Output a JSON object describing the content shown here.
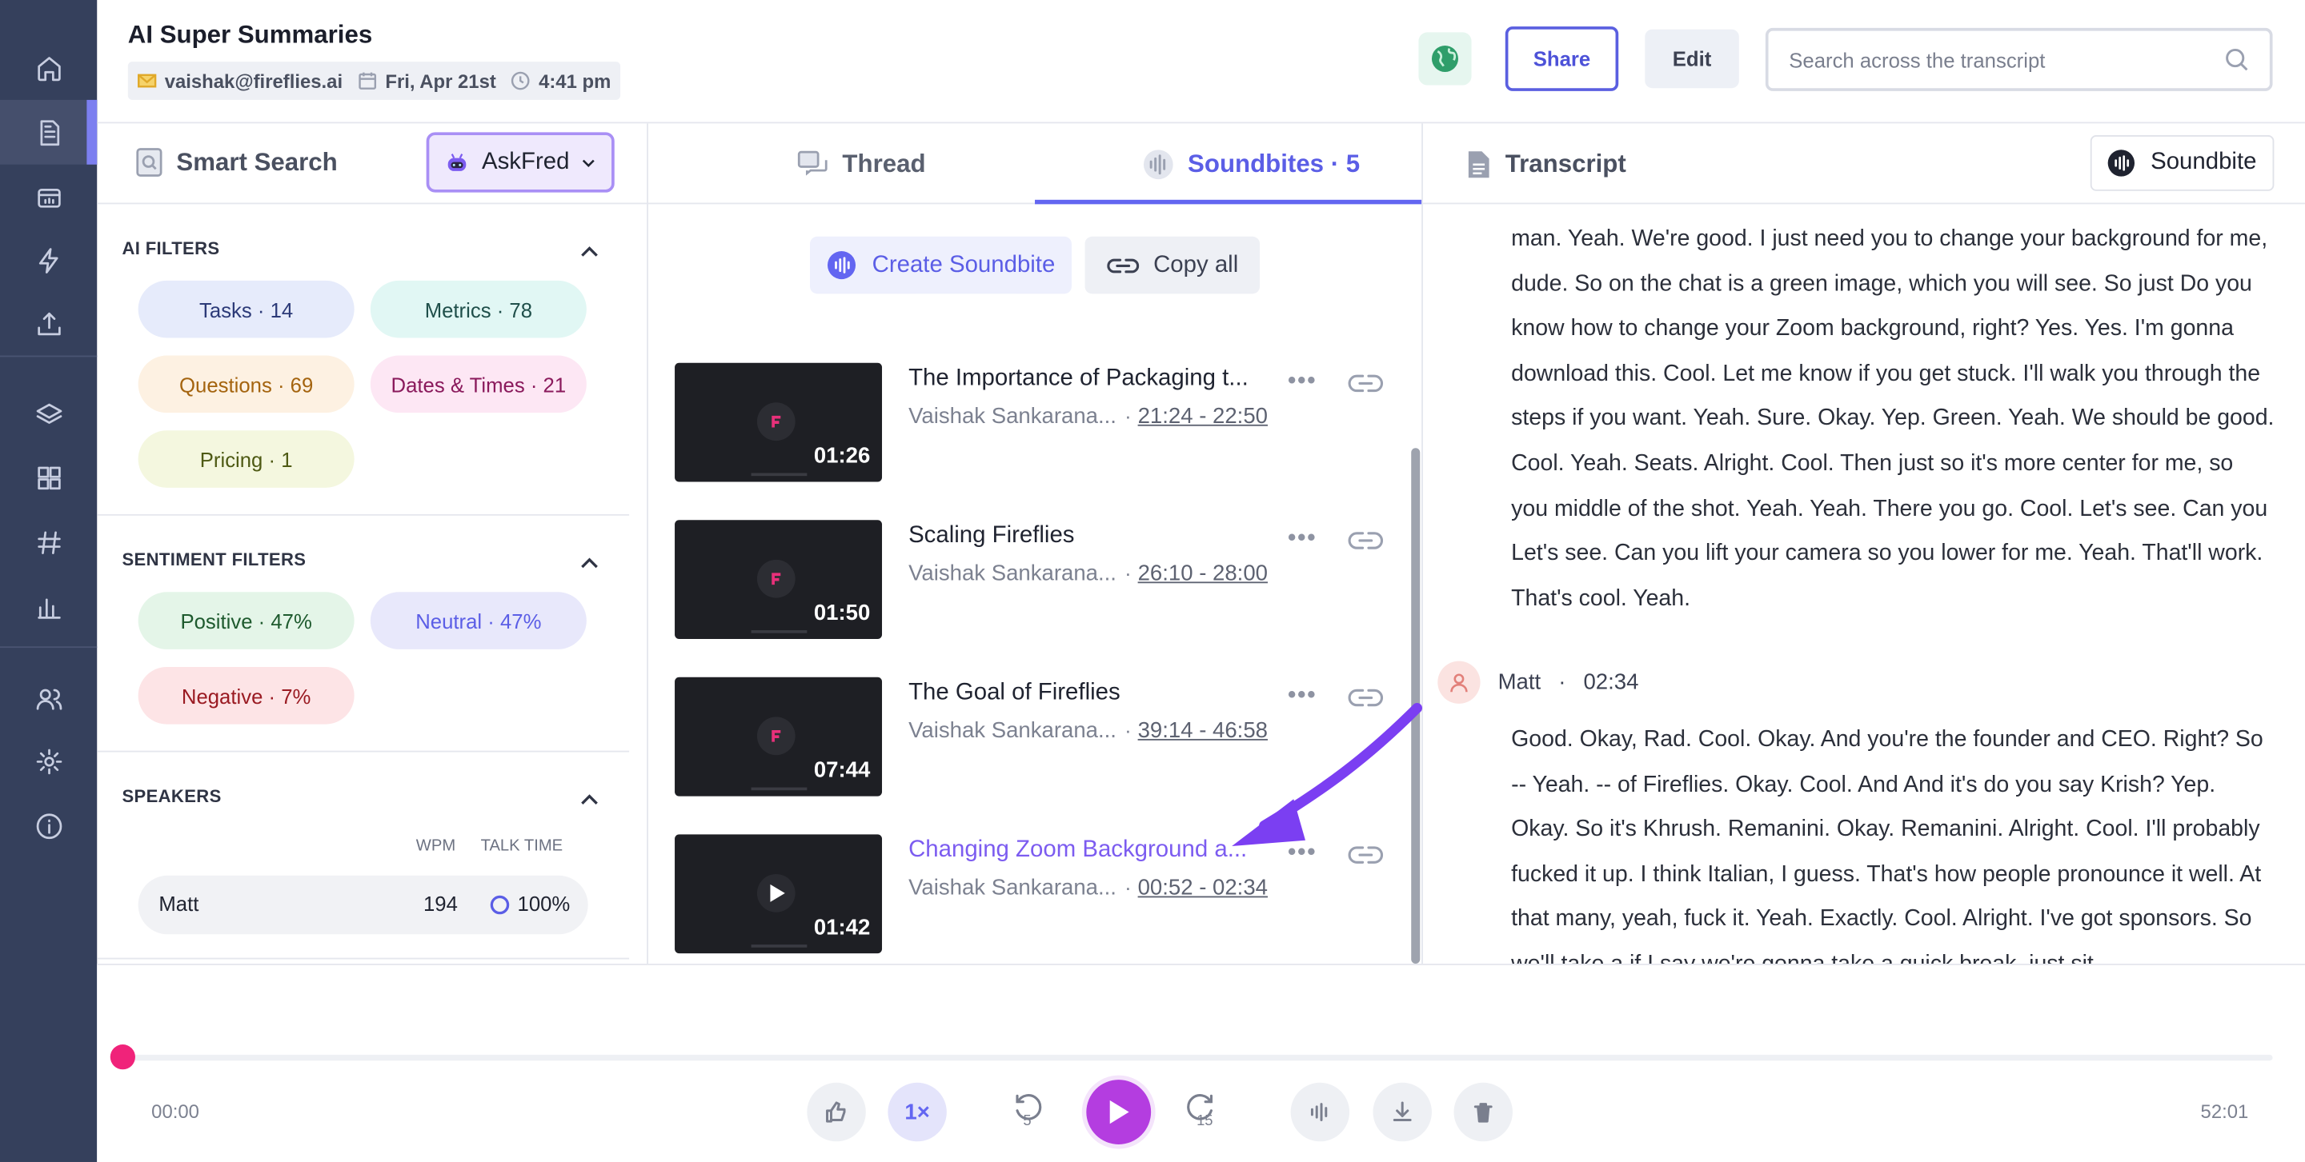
{
  "header": {
    "title": "AI Super Summaries",
    "email": "vaishak@fireflies.ai",
    "date": "Fri, Apr 21st",
    "time": "4:41 pm",
    "share_label": "Share",
    "edit_label": "Edit",
    "search_placeholder": "Search across the transcript"
  },
  "rail": {
    "icons": [
      "home-icon",
      "notes-icon",
      "meetings-icon",
      "bolt-icon",
      "upload-icon",
      "layers-icon",
      "apps-icon",
      "hashtag-icon",
      "analytics-icon",
      "team-icon",
      "settings-icon",
      "info-icon"
    ],
    "active_item": "notes-icon"
  },
  "smart_search": {
    "label": "Smart Search",
    "askfred_label": "AskFred",
    "ai_filters": {
      "title": "AI FILTERS",
      "items": [
        {
          "label": "Tasks · 14",
          "color": "#e6ebfb",
          "text_color": "#2c3a78"
        },
        {
          "label": "Metrics · 78",
          "color": "#e1f7f4",
          "text_color": "#1f4f4a"
        },
        {
          "label": "Questions · 69",
          "color": "#fdf1e2",
          "text_color": "#a4640f"
        },
        {
          "label": "Dates & Times · 21",
          "color": "#fde7f4",
          "text_color": "#8a1a5c"
        },
        {
          "label": "Pricing · 1",
          "color": "#f4f7df",
          "text_color": "#4e5a14"
        }
      ]
    },
    "sentiment_filters": {
      "title": "SENTIMENT FILTERS",
      "items": [
        {
          "label": "Positive · 47%",
          "color": "#e4f5e8",
          "text_color": "#1e5a2e"
        },
        {
          "label": "Neutral · 47%",
          "color": "#e8e8fb",
          "text_color": "#5b5ee6"
        },
        {
          "label": "Negative · 7%",
          "color": "#fde4e6",
          "text_color": "#9a1a22"
        }
      ]
    },
    "speakers": {
      "title": "SPEAKERS",
      "col_wpm": "WPM",
      "col_talk": "TALK TIME",
      "rows": [
        {
          "name": "Matt",
          "wpm": "194",
          "talk": "100%"
        }
      ]
    }
  },
  "middle": {
    "tab_thread": "Thread",
    "tab_soundbites": "Soundbites · 5",
    "create_label": "Create Soundbite",
    "copy_label": "Copy all",
    "clips": [
      {
        "title": "The Importance of Packaging t...",
        "speaker": "Vaishak Sankarana...",
        "range": "21:24 - 22:50",
        "duration": "01:26",
        "active": false
      },
      {
        "title": "Scaling Fireflies",
        "speaker": "Vaishak Sankarana...",
        "range": "26:10 - 28:00",
        "duration": "01:50",
        "active": false
      },
      {
        "title": "The Goal of Fireflies",
        "speaker": "Vaishak Sankarana...",
        "range": "39:14 - 46:58",
        "duration": "07:44",
        "active": false
      },
      {
        "title": "Changing Zoom Background a...",
        "speaker": "Vaishak Sankarana...",
        "range": "00:52 - 02:34",
        "duration": "01:42",
        "active": true
      }
    ]
  },
  "transcript": {
    "label": "Transcript",
    "soundbite_toggle": "Soundbite",
    "para1": "man. Yeah. We're good. I just need you to change your background for me, dude. So on the chat is a green image, which you will see. So just Do you know how to change your Zoom background, right? Yes. Yes. I'm gonna download this. Cool. Let me know if you get stuck. I'll walk you through the steps if you want. Yeah. Sure. Okay. Yep. Green. Yeah. We should be good. Cool. Yeah. Seats. Alright. Cool. Then just so it's more center for me, so you middle of the shot. Yeah. Yeah. There you go. Cool. Let's see. Can you Let's see. Can you lift your camera so you lower for me. Yeah. That'll work. That's cool. Yeah.",
    "speaker": "Matt",
    "speaker_time": "02:34",
    "para2": "Good. Okay, Rad. Cool. Okay. And you're the founder and CEO. Right? So -- Yeah. -- of Fireflies. Okay. Cool. And And it's do you say Krish? Yep. Okay. So it's Khrush. Remanini. Okay. Remanini. Alright. Cool. I'll probably fucked it up. I think Italian, I guess. That's how people pronounce it well. At that many, yeah, fuck it. Yeah. Exactly. Cool. Alright. I've got sponsors. So we'll take a if I say we're gonna take a quick break, just sit"
  },
  "player": {
    "current": "00:00",
    "total": "52:01",
    "speed": "1×",
    "rewind": "5",
    "forward": "15",
    "progress": 0
  }
}
